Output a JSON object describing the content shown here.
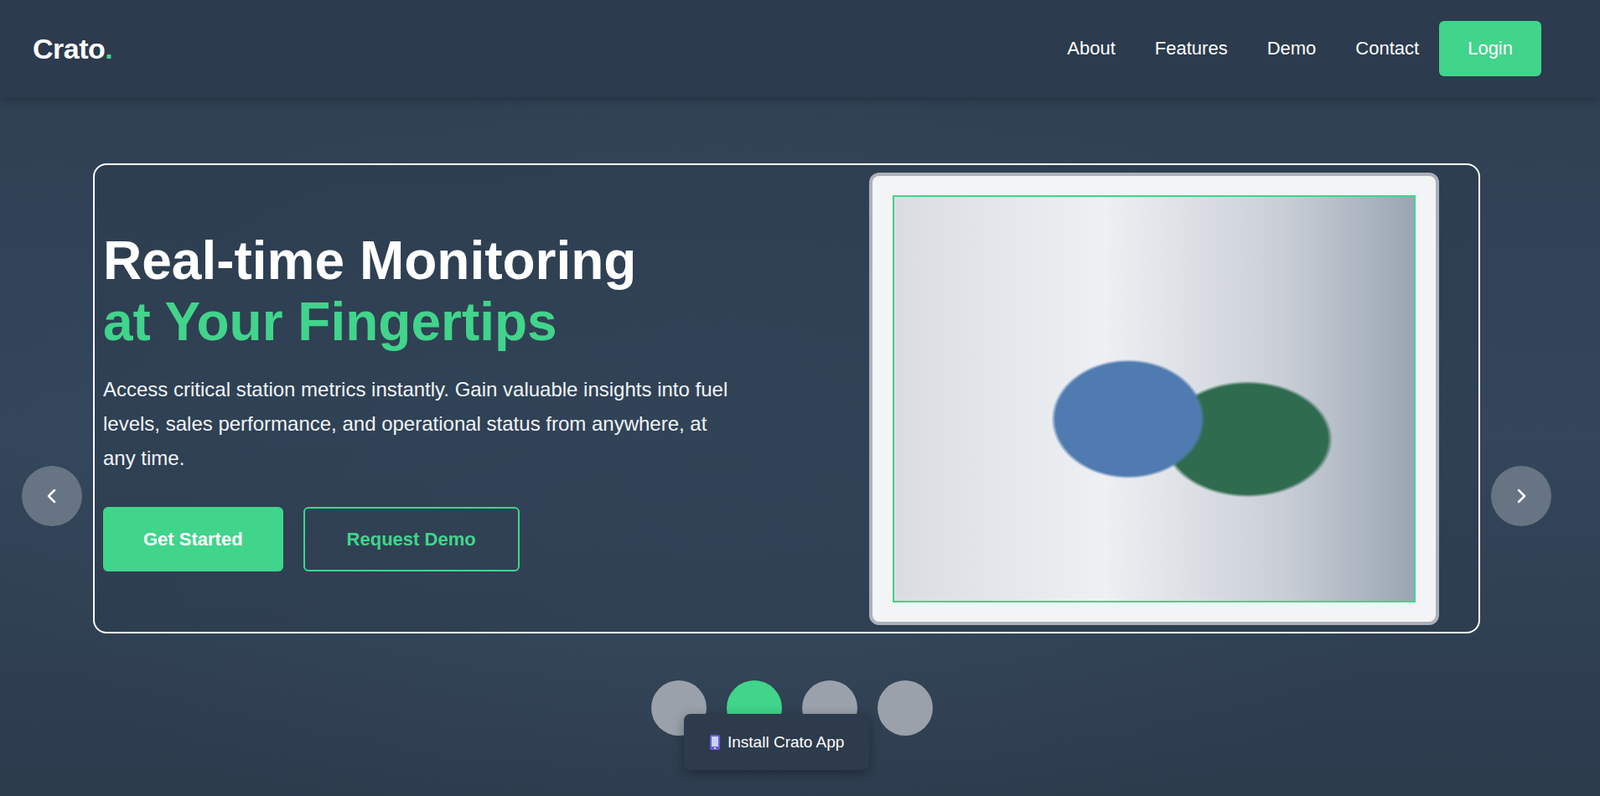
{
  "header": {
    "logo": {
      "text": "Crato",
      "dot": "."
    },
    "nav": [
      {
        "label": "About"
      },
      {
        "label": "Features"
      },
      {
        "label": "Demo"
      },
      {
        "label": "Contact"
      }
    ],
    "login": "Login"
  },
  "hero": {
    "title_line1": "Real-time Monitoring",
    "title_line2": "at Your Fingertips",
    "description": "Access critical station metrics instantly. Gain valuable insights into fuel levels, sales performance, and operational status from anywhere, at any time.",
    "primary_button": "Get Started",
    "secondary_button": "Request Demo"
  },
  "carousel": {
    "dots": [
      {
        "selected": false
      },
      {
        "selected": true
      },
      {
        "selected": false
      },
      {
        "selected": false
      }
    ]
  },
  "install_prompt": {
    "label": "Install Crato App"
  }
}
